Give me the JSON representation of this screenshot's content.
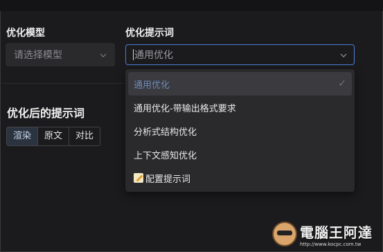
{
  "labels": {
    "model": "优化模型",
    "prompt": "优化提示词",
    "result": "优化后的提示词"
  },
  "model_select": {
    "placeholder": "请选择模型"
  },
  "prompt_select": {
    "value": "通用优化"
  },
  "dropdown": {
    "options": [
      {
        "label": "通用优化",
        "selected": true
      },
      {
        "label": "通用优化-带输出格式要求"
      },
      {
        "label": "分析式结构优化"
      },
      {
        "label": "上下文感知优化"
      },
      {
        "label": "配置提示词",
        "icon": "memo-icon"
      }
    ]
  },
  "tabs": [
    {
      "label": "渲染",
      "active": true
    },
    {
      "label": "原文"
    },
    {
      "label": "对比"
    }
  ],
  "watermark": {
    "title": "電腦王阿達",
    "url": "http://www.kocpc.com.tw"
  },
  "colors": {
    "accent": "#4d7fd6",
    "background": "#1b1b1d",
    "panel": "#2a2a2d"
  }
}
